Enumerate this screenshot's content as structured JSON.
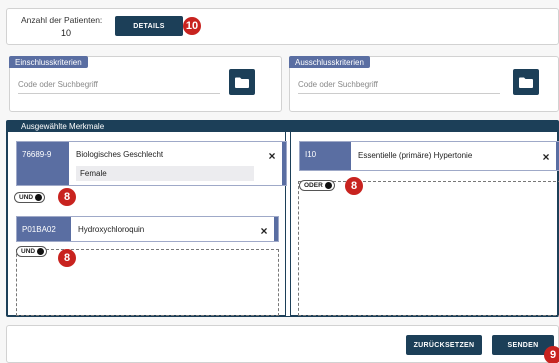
{
  "patients": {
    "label": "Anzahl der Patienten:",
    "count": "10",
    "details_label": "DETAILS",
    "details_badge": "10"
  },
  "inclusion": {
    "title": "Einschlusskriterien",
    "placeholder": "Code oder Suchbegriff",
    "folder_icon": "folder-icon"
  },
  "exclusion": {
    "title": "Ausschlusskriterien",
    "placeholder": "Code oder Suchbegriff",
    "folder_icon": "folder-icon"
  },
  "features": {
    "title": "Ausgewählte Merkmale",
    "left": {
      "cards": [
        {
          "code": "76689-9",
          "name": "Biologisches Geschlecht",
          "selected_value": "Female",
          "close": "×"
        },
        {
          "code": "P01BA02",
          "name": "Hydroxychloroquin",
          "close": "×"
        }
      ],
      "toggles": [
        {
          "label": "UND",
          "badge": "8"
        },
        {
          "label": "UND",
          "badge": "8"
        }
      ]
    },
    "right": {
      "cards": [
        {
          "code": "I10",
          "name": "Essentielle (primäre) Hypertonie",
          "close": "×"
        }
      ],
      "toggles": [
        {
          "label": "ODER",
          "badge": "8"
        }
      ]
    }
  },
  "actions": {
    "reset_label": "ZURÜCKSETZEN",
    "send_label": "SENDEN",
    "send_badge": "9"
  },
  "colors": {
    "primary_dark": "#1c3f58",
    "accent_blue": "#5a6ea2",
    "badge_red": "#c8231f"
  }
}
